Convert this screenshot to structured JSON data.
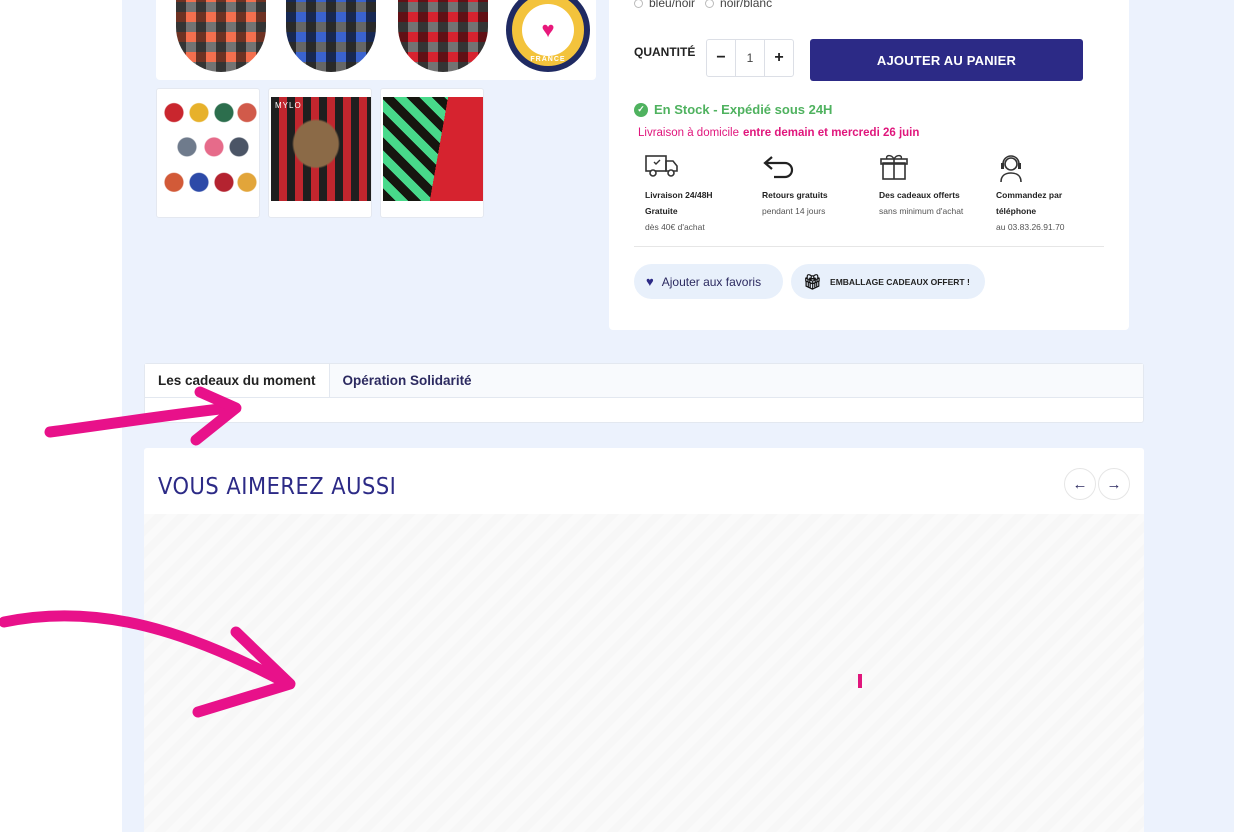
{
  "options": {
    "opt1": "bleu/noir",
    "opt2": "noir/blanc"
  },
  "quantity": {
    "label": "QUANTITÉ",
    "value": "1",
    "minus": "−",
    "plus": "+"
  },
  "cart": {
    "add_label": "AJOUTER AU PANIER"
  },
  "stock": {
    "text": "En Stock - Expédié sous 24H"
  },
  "delivery": {
    "label": "Livraison à domicile",
    "dates": "entre demain et mercredi 26 juin"
  },
  "features": [
    {
      "icon": "delivery-truck-icon",
      "title1": "Livraison 24/48H",
      "title2": "Gratuite",
      "sub": "dès 40€ d'achat"
    },
    {
      "icon": "return-arrow-icon",
      "title1": "Retours gratuits",
      "sub": "pendant 14 jours"
    },
    {
      "icon": "gift-icon",
      "title1": "Des cadeaux offerts",
      "sub": "sans minimum d'achat"
    },
    {
      "icon": "headset-icon",
      "title1": "Commandez par",
      "title2": "téléphone",
      "sub": "au 03.83.26.91.70"
    }
  ],
  "actions": {
    "favorite": "Ajouter aux favoris",
    "gift_wrap": "EMBALLAGE CADEAUX OFFERT !"
  },
  "tabs": [
    "Les cadeaux du moment",
    "Opération Solidarité"
  ],
  "reco": {
    "title": "VOUS AIMEREZ AUSSI",
    "prev": "←",
    "next": "→"
  },
  "gallery": {
    "seal_text": "FRANCE",
    "thumb2_text": "MYLO"
  },
  "colors": {
    "accent": "#2c2a86",
    "pink": "#e0167c",
    "stock_green": "#4fb25f",
    "page_bg": "#ecf2fd"
  }
}
